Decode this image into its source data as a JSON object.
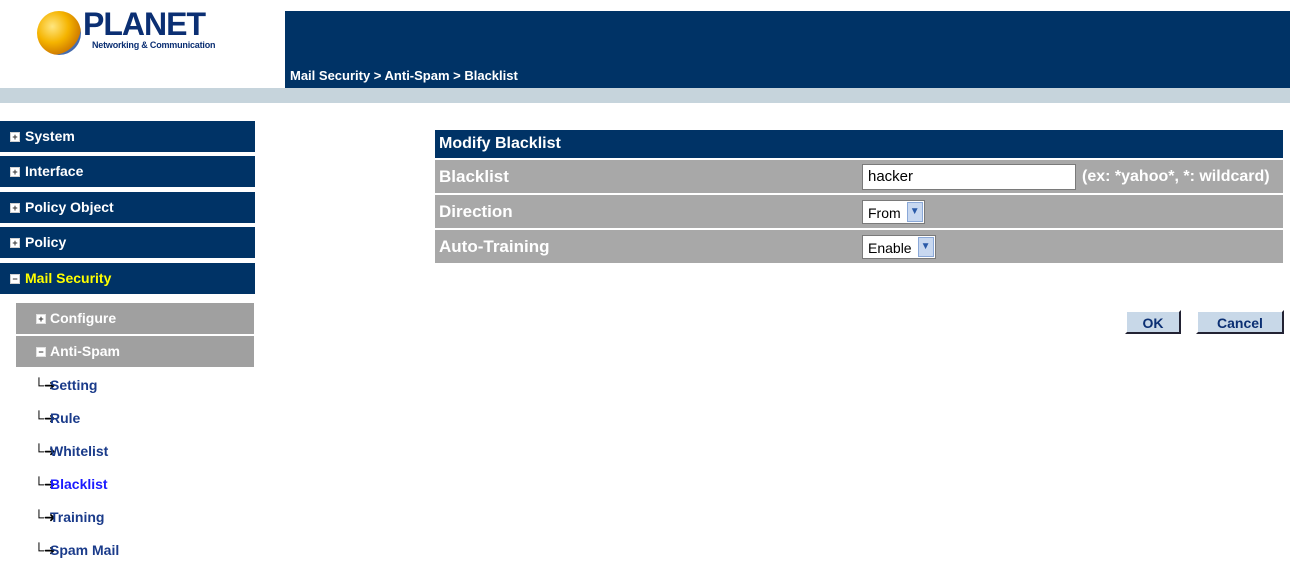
{
  "brand": {
    "name": "PLANET",
    "tagline": "Networking & Communication"
  },
  "header": {
    "breadcrumb": "Mail Security > Anti-Spam > Blacklist"
  },
  "sidebar": {
    "items": [
      {
        "label": "System"
      },
      {
        "label": "Interface"
      },
      {
        "label": "Policy Object"
      },
      {
        "label": "Policy"
      },
      {
        "label": "Mail Security"
      }
    ],
    "sub_items": [
      {
        "label": "Configure"
      },
      {
        "label": "Anti-Spam"
      }
    ],
    "leaves": [
      {
        "label": "Setting"
      },
      {
        "label": "Rule"
      },
      {
        "label": "Whitelist"
      },
      {
        "label": "Blacklist"
      },
      {
        "label": "Training"
      },
      {
        "label": "Spam Mail"
      }
    ]
  },
  "form": {
    "title": "Modify Blacklist",
    "fields": [
      {
        "label": "Blacklist",
        "value": "hacker",
        "hint": "(ex: *yahoo*, *: wildcard)"
      },
      {
        "label": "Direction",
        "value": "From"
      },
      {
        "label": "Auto-Training",
        "value": "Enable"
      }
    ],
    "ok_label": "OK",
    "cancel_label": "Cancel"
  },
  "colors": {
    "nav_bg": "#003366",
    "active_nav_text": "#ffff00",
    "row_bg": "#a8a8a8",
    "strip": "#c6d4dc"
  }
}
